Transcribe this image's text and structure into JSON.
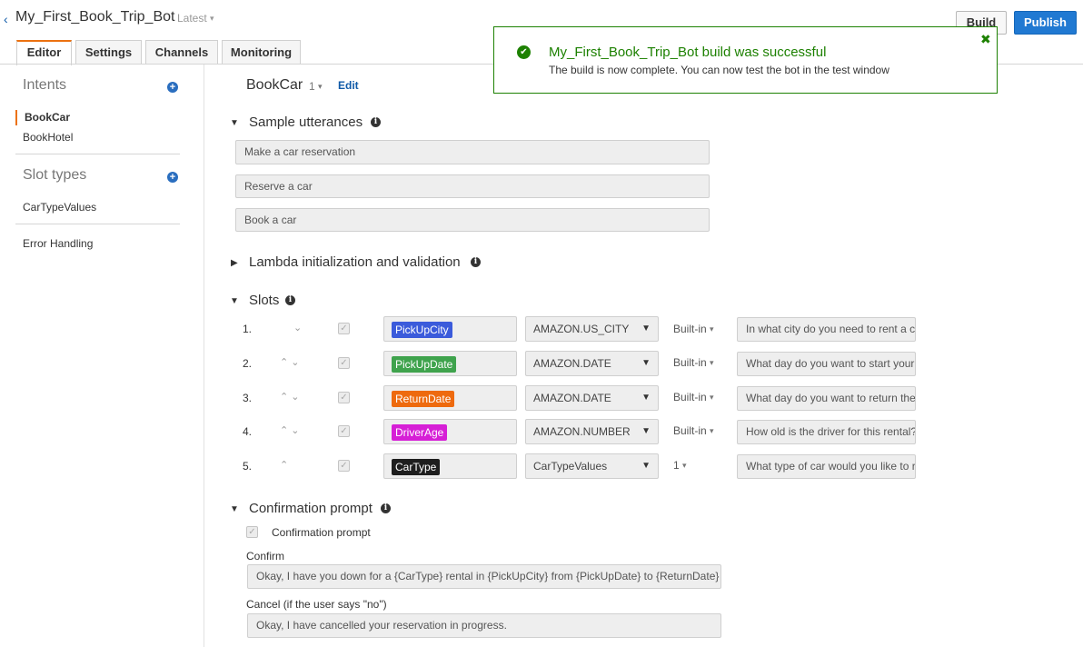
{
  "header": {
    "back_glyph": "‹",
    "bot_name": "My_First_Book_Trip_Bot",
    "version": "Latest",
    "build_label": "Build",
    "publish_label": "Publish"
  },
  "tabs": [
    {
      "label": "Editor",
      "active": true
    },
    {
      "label": "Settings",
      "active": false
    },
    {
      "label": "Channels",
      "active": false
    },
    {
      "label": "Monitoring",
      "active": false
    }
  ],
  "toast": {
    "title": "My_First_Book_Trip_Bot build was successful",
    "message": "The build is now complete. You can now test the bot in the test window",
    "close_glyph": "✖",
    "check_glyph": "✔"
  },
  "sidebar": {
    "intents_heading": "Intents",
    "intents": [
      {
        "label": "BookCar",
        "active": true
      },
      {
        "label": "BookHotel",
        "active": false
      }
    ],
    "slot_types_heading": "Slot types",
    "slot_types": [
      {
        "label": "CarTypeValues"
      }
    ],
    "error_handling": "Error Handling"
  },
  "intent": {
    "name": "BookCar",
    "version": "1",
    "edit_label": "Edit"
  },
  "sample_utterances": {
    "title": "Sample utterances",
    "items": [
      "Make a car reservation",
      "Reserve a car",
      "Book a car"
    ]
  },
  "lambda": {
    "title": "Lambda initialization and validation"
  },
  "slots": {
    "title": "Slots",
    "items": [
      {
        "num": "1.",
        "arrows": "⌄",
        "name": "PickUpCity",
        "color": "#3b5bdb",
        "type": "AMAZON.US_CITY",
        "version": "Built-in",
        "prompt": "In what city do you need to rent a car?"
      },
      {
        "num": "2.",
        "arrows": "⌃ ⌄",
        "name": "PickUpDate",
        "color": "#3fa34d",
        "type": "AMAZON.DATE",
        "version": "Built-in",
        "prompt": "What day do you want to start your rental?"
      },
      {
        "num": "3.",
        "arrows": "⌃ ⌄",
        "name": "ReturnDate",
        "color": "#ee6a0e",
        "type": "AMAZON.DATE",
        "version": "Built-in",
        "prompt": "What day do you want to return the car?"
      },
      {
        "num": "4.",
        "arrows": "⌃ ⌄",
        "name": "DriverAge",
        "color": "#d61fd6",
        "type": "AMAZON.NUMBER",
        "version": "Built-in",
        "prompt": "How old is the driver for this rental?"
      },
      {
        "num": "5.",
        "arrows": "⌃",
        "name": "CarType",
        "color": "#1e1e1e",
        "type": "CarTypeValues",
        "version": "1",
        "prompt": "What type of car would you like to rent?"
      }
    ]
  },
  "confirmation": {
    "title": "Confirmation prompt",
    "checkbox_label": "Confirmation prompt",
    "confirm_label": "Confirm",
    "confirm_value": "Okay, I have you down for a {CarType} rental in {PickUpCity} from {PickUpDate} to {ReturnDate}",
    "cancel_label": "Cancel (if the user says \"no\")",
    "cancel_value": "Okay, I have cancelled your reservation in progress."
  },
  "icons": {
    "caret_down": "▾",
    "tri_down": "▼",
    "tri_right": "▶",
    "info": "i",
    "plus": "+",
    "check": "✓"
  }
}
